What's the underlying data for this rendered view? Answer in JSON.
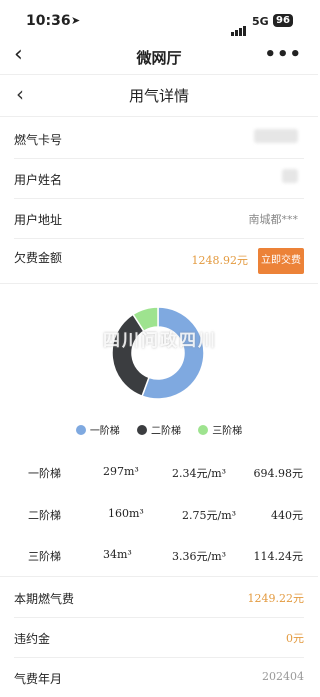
{
  "status": {
    "time": "10:36",
    "network": "5G",
    "battery": "96"
  },
  "nav": {
    "title": "微网厅"
  },
  "page": {
    "title": "用气详情"
  },
  "fields": [
    {
      "label": "燃气卡号",
      "value": ""
    },
    {
      "label": "用户姓名",
      "value": ""
    },
    {
      "label": "用户地址",
      "value": "南城都***"
    },
    {
      "label": "欠费金额",
      "value": "1248.92元"
    }
  ],
  "pay_button": "立即交费",
  "watermark": "四川问政四川",
  "legend": [
    "一阶梯",
    "二阶梯",
    "三阶梯"
  ],
  "colors": {
    "tier1": "#7fa9e0",
    "tier2": "#3b3d40",
    "tier3": "#9ee38f",
    "accent": "#ec8238",
    "amount": "#e39a3f"
  },
  "chart_data": {
    "type": "pie",
    "categories": [
      "一阶梯",
      "二阶梯",
      "三阶梯"
    ],
    "values": [
      694.98,
      440,
      114.24
    ]
  },
  "tiers": [
    {
      "name": "一阶梯",
      "volume": "297m³",
      "price": "2.34元/m³",
      "amount": "694.98元"
    },
    {
      "name": "二阶梯",
      "volume": "160m³",
      "price": "2.75元/m³",
      "amount": "440元"
    },
    {
      "name": "三阶梯",
      "volume": "34m³",
      "price": "3.36元/m³",
      "amount": "114.24元"
    }
  ],
  "summary": [
    {
      "label": "本期燃气费",
      "value": "1249.22元"
    },
    {
      "label": "违约金",
      "value": "0元"
    },
    {
      "label": "气费年月",
      "value": "202404"
    }
  ]
}
